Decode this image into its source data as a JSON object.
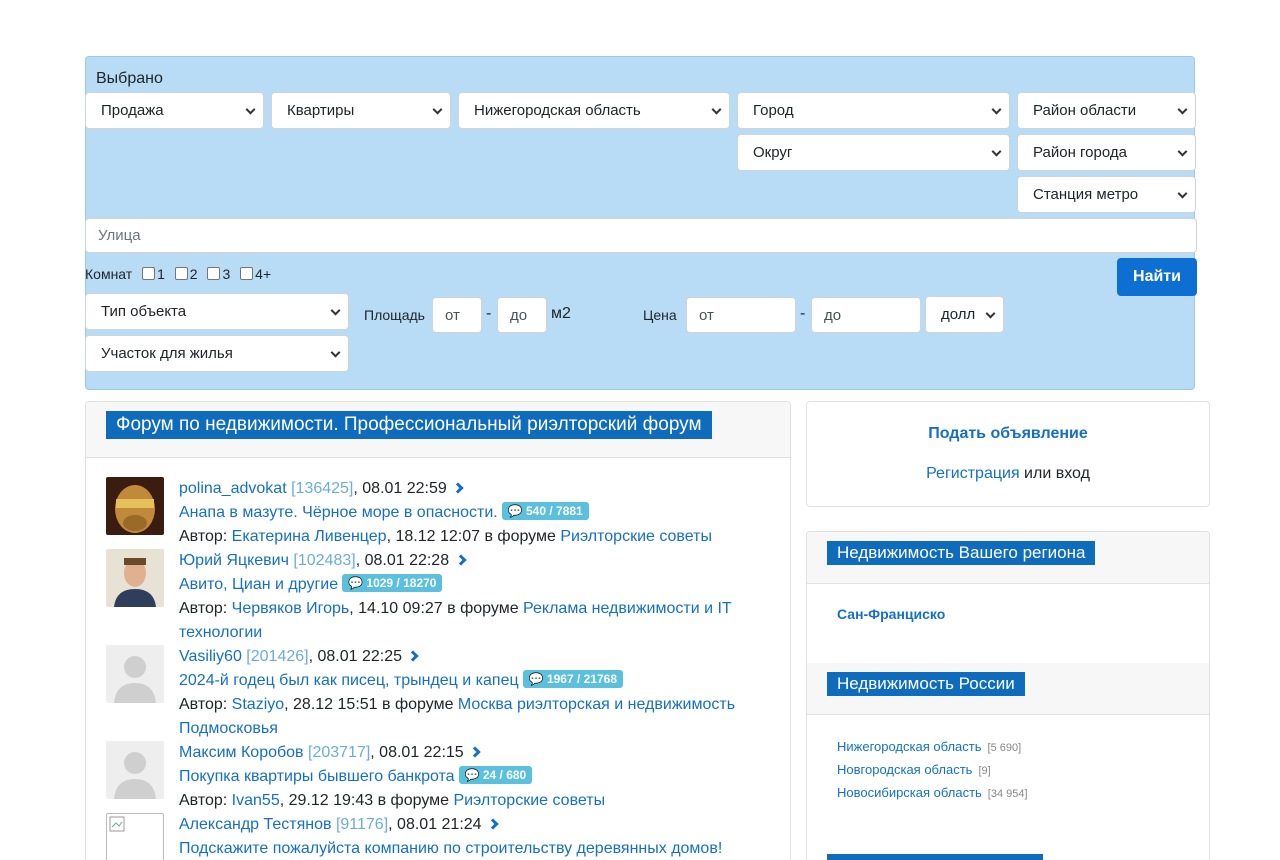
{
  "search": {
    "title": "Выбрано",
    "deal": "Продажа",
    "type": "Квартиры",
    "region": "Нижегородская область",
    "city": "Город",
    "area_region": "Район области",
    "okrug": "Округ",
    "area_city": "Район города",
    "metro": "Станция метро",
    "street_placeholder": "Улица",
    "rooms_label": "Комнат",
    "rooms": [
      "1",
      "2",
      "3",
      "4+"
    ],
    "find_label": "Найти",
    "object_type": "Тип объекта",
    "plot_type": "Участок для жилья",
    "area_label": "Площадь",
    "area_from": "от",
    "area_to": "до",
    "area_unit": "м2",
    "price_label": "Цена",
    "price_from": "от",
    "price_to": "до",
    "currency": "долл",
    "dash": "-"
  },
  "forum": {
    "title": "Форум по недвижимости. Профессиональный риэлторский форум",
    "author_prefix": "Автор:",
    "in_forum": "в форуме",
    "posts": [
      {
        "user": "polina_advokat",
        "user_id": "[136425]",
        "time": ", 08.01 22:59",
        "topic": "Анапа в мазуте. Чёрное море в опасности.",
        "stats": "540 / 7881",
        "author": "Екатерина Ливенцер",
        "author_time": ", 18.12 12:07",
        "forum": "Риэлторские советы"
      },
      {
        "user": "Юрий Яцкевич",
        "user_id": "[102483]",
        "time": ", 08.01 22:28",
        "topic": "Авито, Циан и другие",
        "stats": "1029 / 18270",
        "author": "Червяков Игорь",
        "author_time": ", 14.10 09:27",
        "forum": "Реклама недвижимости и IT технологии"
      },
      {
        "user": "Vasiliy60",
        "user_id": "[201426]",
        "time": ", 08.01 22:25",
        "topic": "2024-й годец был как писец, трындец и капец",
        "stats": "1967 / 21768",
        "author": "Staziyo",
        "author_time": ", 28.12 15:51",
        "forum": "Москва риэлторская и недвижимость Подмосковья"
      },
      {
        "user": "Максим Коробов",
        "user_id": "[203717]",
        "time": ", 08.01 22:15",
        "topic": "Покупка квартиры бывшего банкрота",
        "stats": "24 / 680",
        "author": "Ivan55",
        "author_time": ", 29.12 19:43",
        "forum": "Риэлторские советы"
      },
      {
        "user": "Александр Тестянов",
        "user_id": "[91176]",
        "time": ", 08.01 21:24",
        "topic": "Подскажите пожалуйста компанию по строительству деревянных домов!"
      }
    ]
  },
  "sidebar": {
    "post_ad": "Подать объявление",
    "register": "Регистрация",
    "or_login": " или вход",
    "your_region_title": "Недвижимость Вашего региона",
    "your_region_city": "Сан-Франциско",
    "russia_title": "Недвижимость России",
    "regions": [
      {
        "name": "Нижегородская область",
        "count": "[5 690]"
      },
      {
        "name": "Новгородская область",
        "count": "[9]"
      },
      {
        "name": "Новосибирская область",
        "count": "[34 954]"
      }
    ]
  },
  "colors": {
    "panel_bg": "#b8dcf5",
    "brand_blue": "#0f6cbd",
    "link": "#1470c7",
    "badge": "#5bc0de"
  }
}
